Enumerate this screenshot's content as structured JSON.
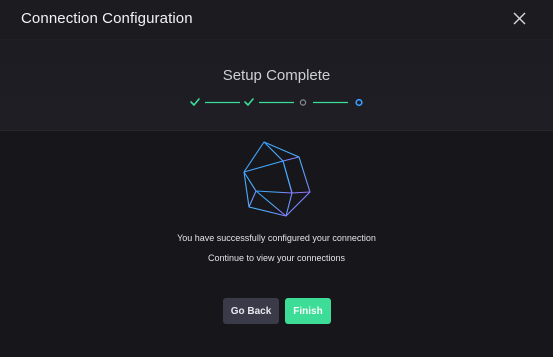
{
  "dialog": {
    "title": "Connection Configuration"
  },
  "stepper": {
    "title": "Setup Complete",
    "steps": [
      {
        "status": "complete"
      },
      {
        "status": "complete"
      },
      {
        "status": "pending"
      },
      {
        "status": "current"
      }
    ]
  },
  "messages": {
    "success": "You have successfully configured your connection",
    "continue": "Continue to view your connections"
  },
  "actions": {
    "back_label": "Go Back",
    "finish_label": "Finish"
  },
  "colors": {
    "accent_green": "#3ddc97",
    "accent_blue": "#3aa0ff",
    "pending_gray": "#8a8a96",
    "back_button": "#3a3a48"
  },
  "icons": {
    "close": "close-icon",
    "complete_step": "checkmark-icon",
    "illustration": "polyhedron-icon"
  }
}
